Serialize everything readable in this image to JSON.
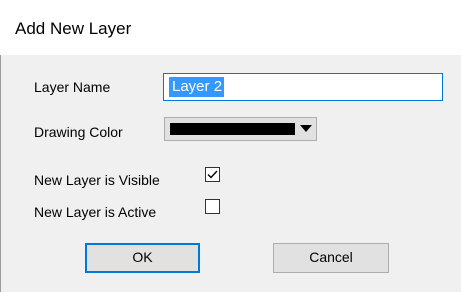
{
  "dialog": {
    "title": "Add New Layer"
  },
  "form": {
    "layer_name_label": "Layer Name",
    "layer_name_value": "Layer 2",
    "drawing_color_label": "Drawing Color",
    "drawing_color_value": "#000000",
    "visible_label": "New Layer is Visible",
    "visible_checked": true,
    "active_label": "New Layer is Active",
    "active_checked": false
  },
  "buttons": {
    "ok_label": "OK",
    "cancel_label": "Cancel"
  },
  "icons": {
    "dropdown": "chevron-down-icon",
    "check": "checkmark-icon"
  },
  "colors": {
    "accent": "#0078d7",
    "selection": "#3399ff",
    "client_bg": "#f0f0f0"
  }
}
